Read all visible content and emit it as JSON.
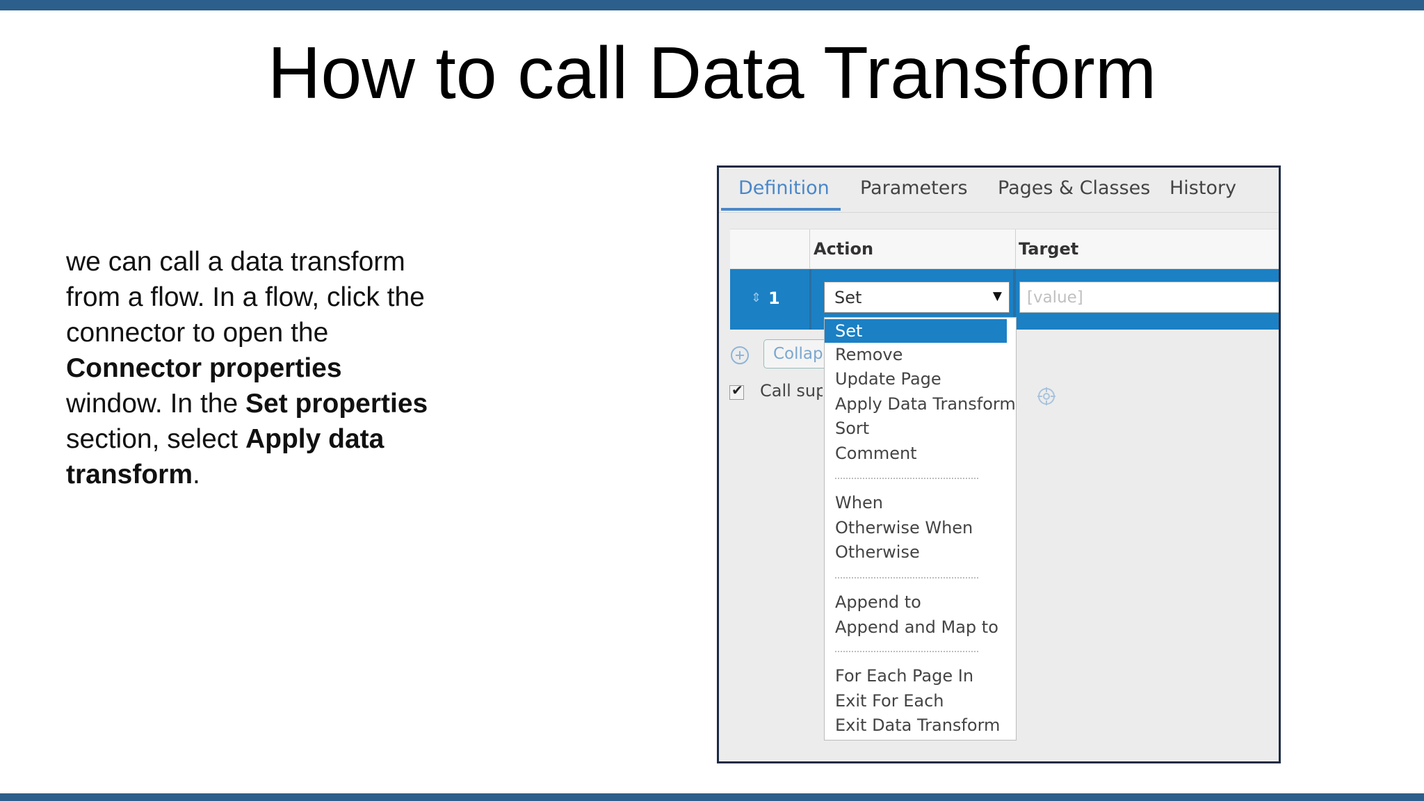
{
  "slide": {
    "title": "How to call Data Transform",
    "body": {
      "t1": "we can call a data transform from a flow. In a flow, click the connector to open the ",
      "b1": "Connector properties",
      "t2": " window. In the ",
      "b2": "Set properties",
      "t3": " section, select ",
      "b3": "Apply data transform",
      "t4": "."
    },
    "colors": {
      "accent_bar": "#2c5f8c",
      "selection": "#1b80c4",
      "tab_active": "#4a87c9"
    }
  },
  "panel": {
    "tabs": [
      {
        "label": "Definition",
        "active": true
      },
      {
        "label": "Parameters",
        "active": false
      },
      {
        "label": "Pages & Classes",
        "active": false
      },
      {
        "label": "History",
        "active": false
      }
    ],
    "grid": {
      "headers": {
        "action": "Action",
        "target": "Target"
      },
      "row": {
        "number": "1",
        "action_value": "Set",
        "target_placeholder": "[value]"
      }
    },
    "collapse_label": "Collapse",
    "call_label": "Call super",
    "dropdown": {
      "items": [
        {
          "label": "Set",
          "selected": true
        },
        {
          "label": "Remove"
        },
        {
          "label": "Update Page"
        },
        {
          "label": "Apply Data Transform"
        },
        {
          "label": "Sort"
        },
        {
          "label": "Comment"
        },
        {
          "label": "When"
        },
        {
          "label": "Otherwise When"
        },
        {
          "label": "Otherwise"
        },
        {
          "label": "Append to"
        },
        {
          "label": "Append and Map to"
        },
        {
          "label": "For Each Page In"
        },
        {
          "label": "Exit For Each"
        },
        {
          "label": "Exit Data Transform"
        }
      ]
    }
  }
}
